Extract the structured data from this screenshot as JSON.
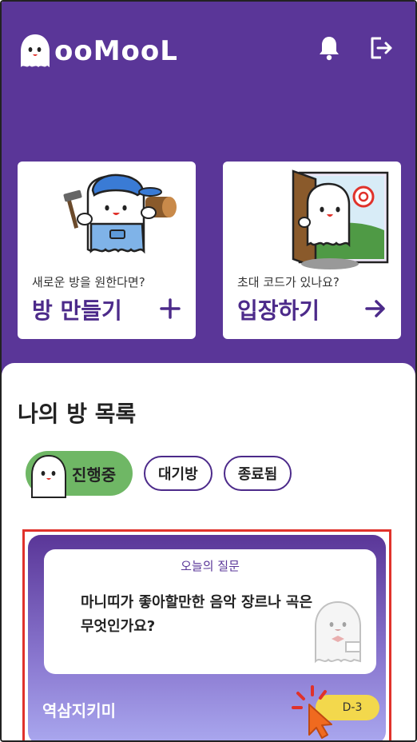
{
  "header": {
    "logo_text": "ooMooL",
    "icons": [
      "bell-icon",
      "logout-icon"
    ]
  },
  "cards": {
    "create": {
      "subtitle": "새로운 방을 원한다면?",
      "title": "방 만들기",
      "action_icon": "plus-icon"
    },
    "enter": {
      "subtitle": "초대 코드가 있나요?",
      "title": "입장하기",
      "action_icon": "arrow-right-icon"
    }
  },
  "my_rooms": {
    "title": "나의 방 목록",
    "tabs": {
      "active": "진행중",
      "waiting": "대기방",
      "ended": "종료됨"
    }
  },
  "room_card": {
    "question_label": "오늘의 질문",
    "question_text": "마니띠가 좋아할만한 음악 장르나 곡은 무엇인가요?",
    "room_name": "역삼지키미",
    "dday": "D-3"
  },
  "colors": {
    "brand_purple": "#5a3698",
    "active_tab_green": "#6fb765",
    "dday_yellow": "#f3d84c",
    "highlight_red": "#e0322b"
  }
}
